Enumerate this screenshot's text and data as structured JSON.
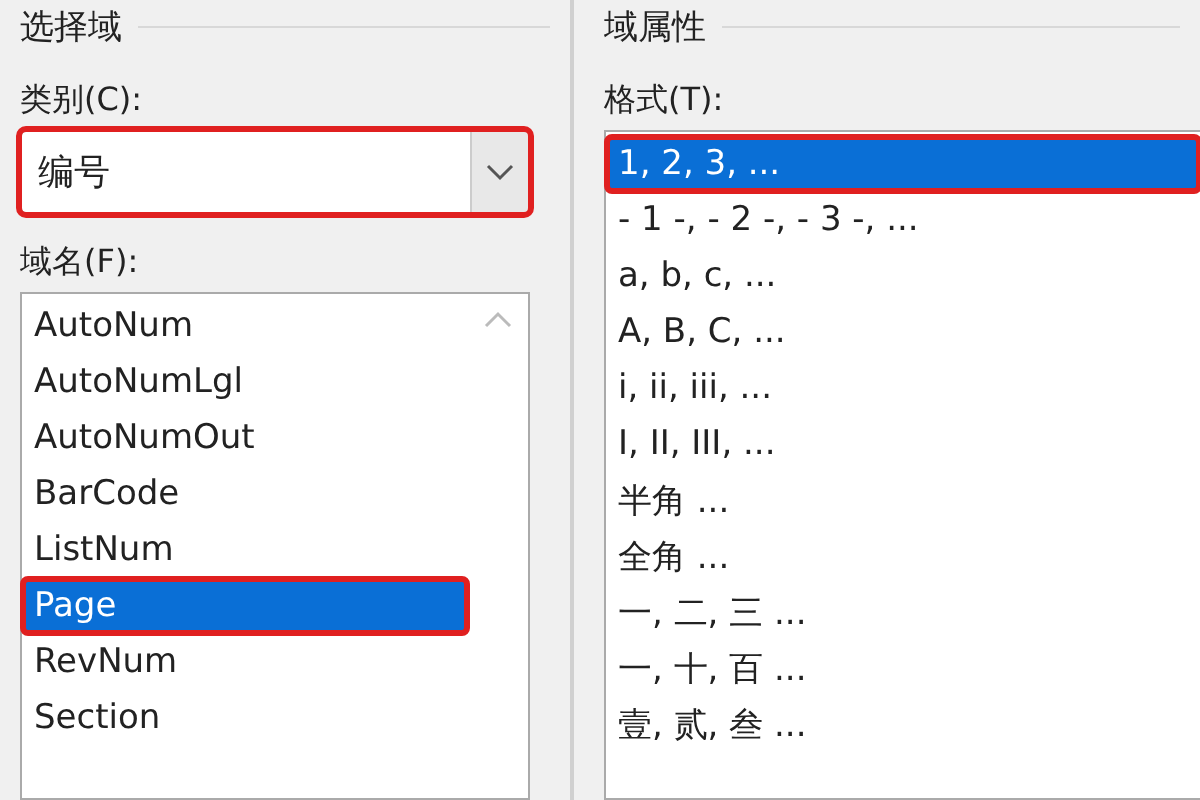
{
  "left_group": {
    "title": "选择域",
    "category_label": "类别(C):",
    "category": {
      "value": "编号",
      "highlighted": true
    },
    "field_names_label": "域名(F):",
    "field_names": [
      {
        "label": "AutoNum",
        "selected": false,
        "highlighted": false
      },
      {
        "label": "AutoNumLgl",
        "selected": false,
        "highlighted": false
      },
      {
        "label": "AutoNumOut",
        "selected": false,
        "highlighted": false
      },
      {
        "label": "BarCode",
        "selected": false,
        "highlighted": false
      },
      {
        "label": "ListNum",
        "selected": false,
        "highlighted": false
      },
      {
        "label": "Page",
        "selected": true,
        "highlighted": true
      },
      {
        "label": "RevNum",
        "selected": false,
        "highlighted": false
      },
      {
        "label": "Section",
        "selected": false,
        "highlighted": false
      }
    ]
  },
  "right_group": {
    "title": "域属性",
    "format_label": "格式(T):",
    "formats": [
      {
        "label": "1, 2, 3, ...",
        "selected": true,
        "highlighted": true
      },
      {
        "label": "- 1 -, - 2 -, - 3 -, ...",
        "selected": false,
        "highlighted": false
      },
      {
        "label": "a, b, c, ...",
        "selected": false,
        "highlighted": false
      },
      {
        "label": "A, B, C, ...",
        "selected": false,
        "highlighted": false
      },
      {
        "label": "i, ii, iii, ...",
        "selected": false,
        "highlighted": false
      },
      {
        "label": "I, II, III, ...",
        "selected": false,
        "highlighted": false
      },
      {
        "label": "半角 ...",
        "selected": false,
        "highlighted": false
      },
      {
        "label": "全角 ...",
        "selected": false,
        "highlighted": false
      },
      {
        "label": "一, 二, 三 ...",
        "selected": false,
        "highlighted": false
      },
      {
        "label": "一, 十, 百 ...",
        "selected": false,
        "highlighted": false
      },
      {
        "label": "壹, 贰, 叁 ...",
        "selected": false,
        "highlighted": false
      }
    ]
  }
}
